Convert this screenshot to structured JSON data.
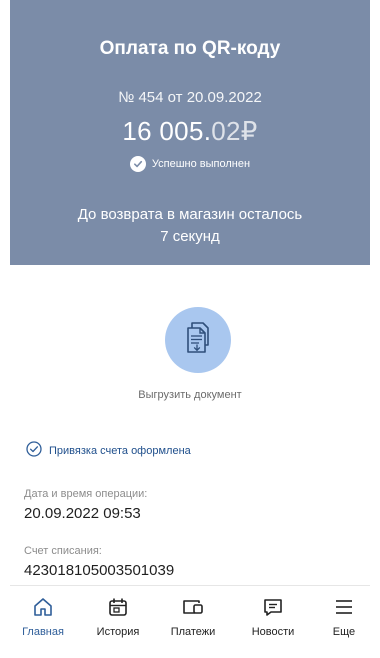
{
  "header": {
    "title": "Оплата по QR-коду",
    "number": "№ 454 от 20.09.2022",
    "amount_main": "16 005.",
    "amount_kop": "02",
    "currency": "₽",
    "status": "Успешно выполнен",
    "return_line1": "До возврата в магазин осталось",
    "return_line2": "7 секунд"
  },
  "actions": {
    "export_label": "Выгрузить документ"
  },
  "details": {
    "linked_status": "Привязка счета оформлена",
    "datetime_label": "Дата и время операции:",
    "datetime_value": "20.09.2022 09:53",
    "account_label": "Счет списания:",
    "account_value": "423018105003501039"
  },
  "tabbar": {
    "tabs": [
      {
        "label": "Главная",
        "icon": "home-icon",
        "active": true
      },
      {
        "label": "История",
        "icon": "calendar-icon",
        "active": false
      },
      {
        "label": "Платежи",
        "icon": "card-icon",
        "active": false
      },
      {
        "label": "Новости",
        "icon": "chat-icon",
        "active": false
      },
      {
        "label": "Еще",
        "icon": "menu-icon",
        "active": false
      }
    ]
  },
  "colors": {
    "header_bg": "#7b8ca8",
    "accent": "#2f5e99",
    "doc_circle": "#a9c7ef"
  }
}
